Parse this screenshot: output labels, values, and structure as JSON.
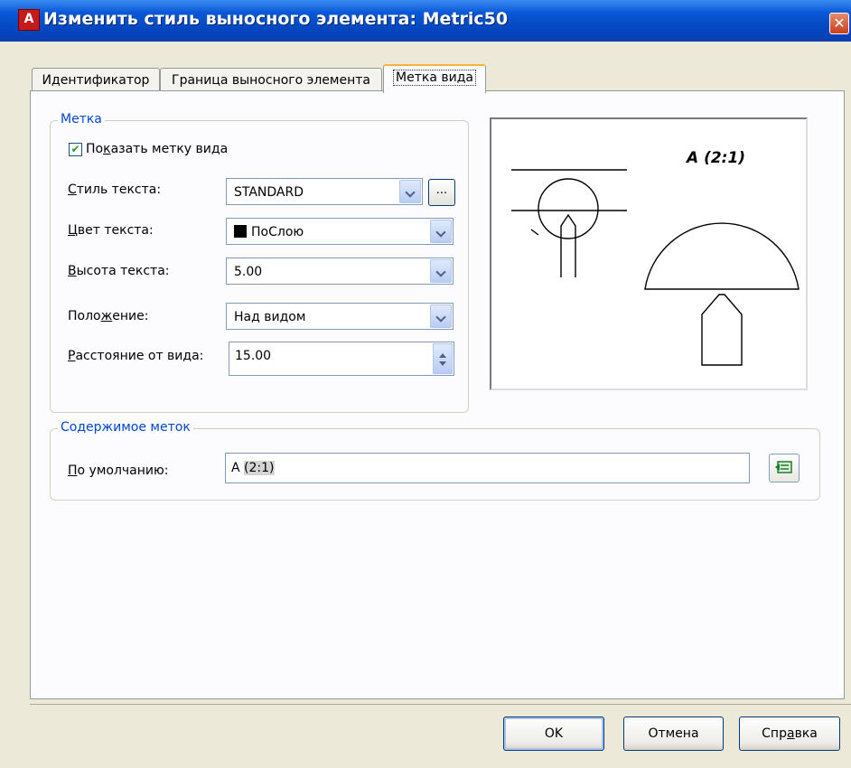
{
  "window": {
    "title": "Изменить стиль выносного элемента: Metric50",
    "app_icon_letter": "A",
    "close_glyph": "✕"
  },
  "tabs": [
    {
      "label": "Идентификатор",
      "active": false
    },
    {
      "label": "Граница выносного элемента",
      "active": false
    },
    {
      "label": "Метка вида",
      "active": true
    }
  ],
  "label_group": {
    "title": "Метка",
    "show_label": {
      "text_before": "По",
      "mnemonic": "к",
      "text_after": "азать метку вида",
      "checked": true
    },
    "text_style": {
      "label_mnemonic": "С",
      "label_rest": "тиль текста:",
      "value": "STANDARD",
      "more_button": "..."
    },
    "text_color": {
      "label_mnemonic": "Ц",
      "label_rest": "вет текста:",
      "value": "ПоСлою",
      "swatch_color": "#000000"
    },
    "text_height": {
      "label_mnemonic": "В",
      "label_rest": "ысота текста:",
      "value": "5.00"
    },
    "position": {
      "label_before": "Поло",
      "label_mnemonic": "ж",
      "label_after": "ение:",
      "value": "Над видом"
    },
    "distance": {
      "label_mnemonic": "Р",
      "label_rest": "асстояние от вида:",
      "value": "15.00"
    }
  },
  "preview": {
    "label_text": "A (2:1)"
  },
  "contents_group": {
    "title": "Содержимое меток",
    "default": {
      "label_mnemonic": "П",
      "label_rest": "о умолчанию:",
      "value_prefix": "A ",
      "value_field": "(2:1)"
    }
  },
  "buttons": {
    "ok": "OK",
    "cancel": "Отмена",
    "help_before": "Спр",
    "help_mnemonic": "а",
    "help_after": "вка"
  }
}
